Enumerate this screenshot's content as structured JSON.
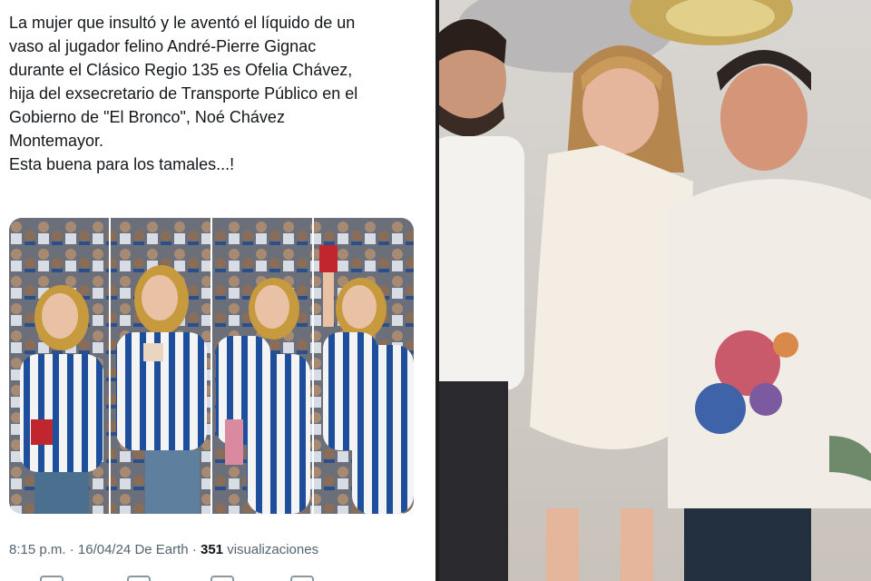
{
  "tweet": {
    "text_lines": [
      "La mujer que insultó y le aventó el líquido de un",
      "vaso al jugador felino André-Pierre Gignac",
      "durante el Clásico Regio 135 es Ofelia Chávez,",
      "hija del exsecretario de Transporte Público en el",
      "Gobierno de \"El Bronco\", Noé Chávez",
      "Montemayor.",
      "Esta buena para los tamales...!"
    ],
    "time": "8:15 p.m.",
    "separator": " · ",
    "date": "16/04/24",
    "source": "De Earth",
    "views_count": "351",
    "views_label": "visualizaciones",
    "action_icons": [
      "reply-icon",
      "retweet-icon",
      "like-icon",
      "bookmark-icon"
    ]
  },
  "colors": {
    "text": "#14171a",
    "meta": "#536471",
    "jersey_blue": "#1d4f9c",
    "divider": "#1e1e1e"
  }
}
